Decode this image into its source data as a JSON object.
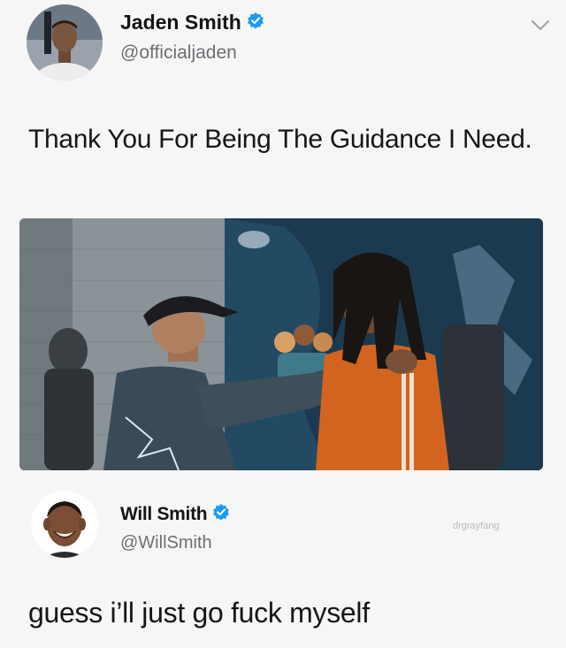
{
  "tweet1": {
    "display_name": "Jaden Smith",
    "handle": "@officialjaden",
    "text": "Thank You For Being The Guidance I Need."
  },
  "tweet2": {
    "display_name": "Will Smith",
    "handle": "@WillSmith",
    "text": "guess i’ll just go fuck myself",
    "watermark": "drgrayfang"
  },
  "icons": {
    "verified": "verified-badge-icon",
    "menu": "chevron-down-icon"
  },
  "colors": {
    "verified_blue": "#1d9bf0",
    "background": "#f6f6f6",
    "name_text": "#141414",
    "handle_text": "#6b6f73"
  }
}
